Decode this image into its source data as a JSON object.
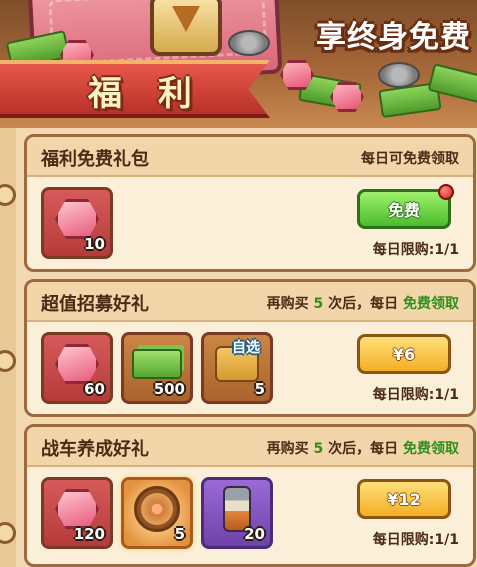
{
  "banner": {
    "promo_top": "",
    "promo_text": "享终身免费",
    "title": "福 利"
  },
  "panels": [
    {
      "title": "福利免费礼包",
      "note_plain": "每日可免费领取",
      "items": [
        {
          "icon": "gem-icon",
          "qty": "10"
        }
      ],
      "button_label": "免费",
      "button_style": "green",
      "has_red_dot": true,
      "limit": "每日限购:1/1"
    },
    {
      "title": "超值招募好礼",
      "note_pre": "再购买",
      "note_num": "5",
      "note_mid": "次后，每日",
      "note_free": "免费领取",
      "items": [
        {
          "icon": "gem-icon",
          "qty": "60"
        },
        {
          "icon": "cash-icon",
          "qty": "500"
        },
        {
          "icon": "puzzle-icon",
          "qty": "5",
          "tag": "自选"
        }
      ],
      "button_label": "¥6",
      "button_style": "yellow",
      "limit": "每日限购:1/1"
    },
    {
      "title": "战车养成好礼",
      "note_pre": "再购买",
      "note_num": "5",
      "note_mid": "次后，每日",
      "note_free": "免费领取",
      "items": [
        {
          "icon": "gem-icon",
          "qty": "120"
        },
        {
          "icon": "wheel-icon",
          "qty": "5"
        },
        {
          "icon": "can-icon",
          "qty": "20"
        }
      ],
      "button_label": "¥12",
      "button_style": "yellow",
      "limit": "每日限购:1/1"
    }
  ],
  "colors": {
    "accent_green": "#2f8f1e",
    "panel_bg": "#fbefd9",
    "ribbon_red": "#d9463a"
  }
}
